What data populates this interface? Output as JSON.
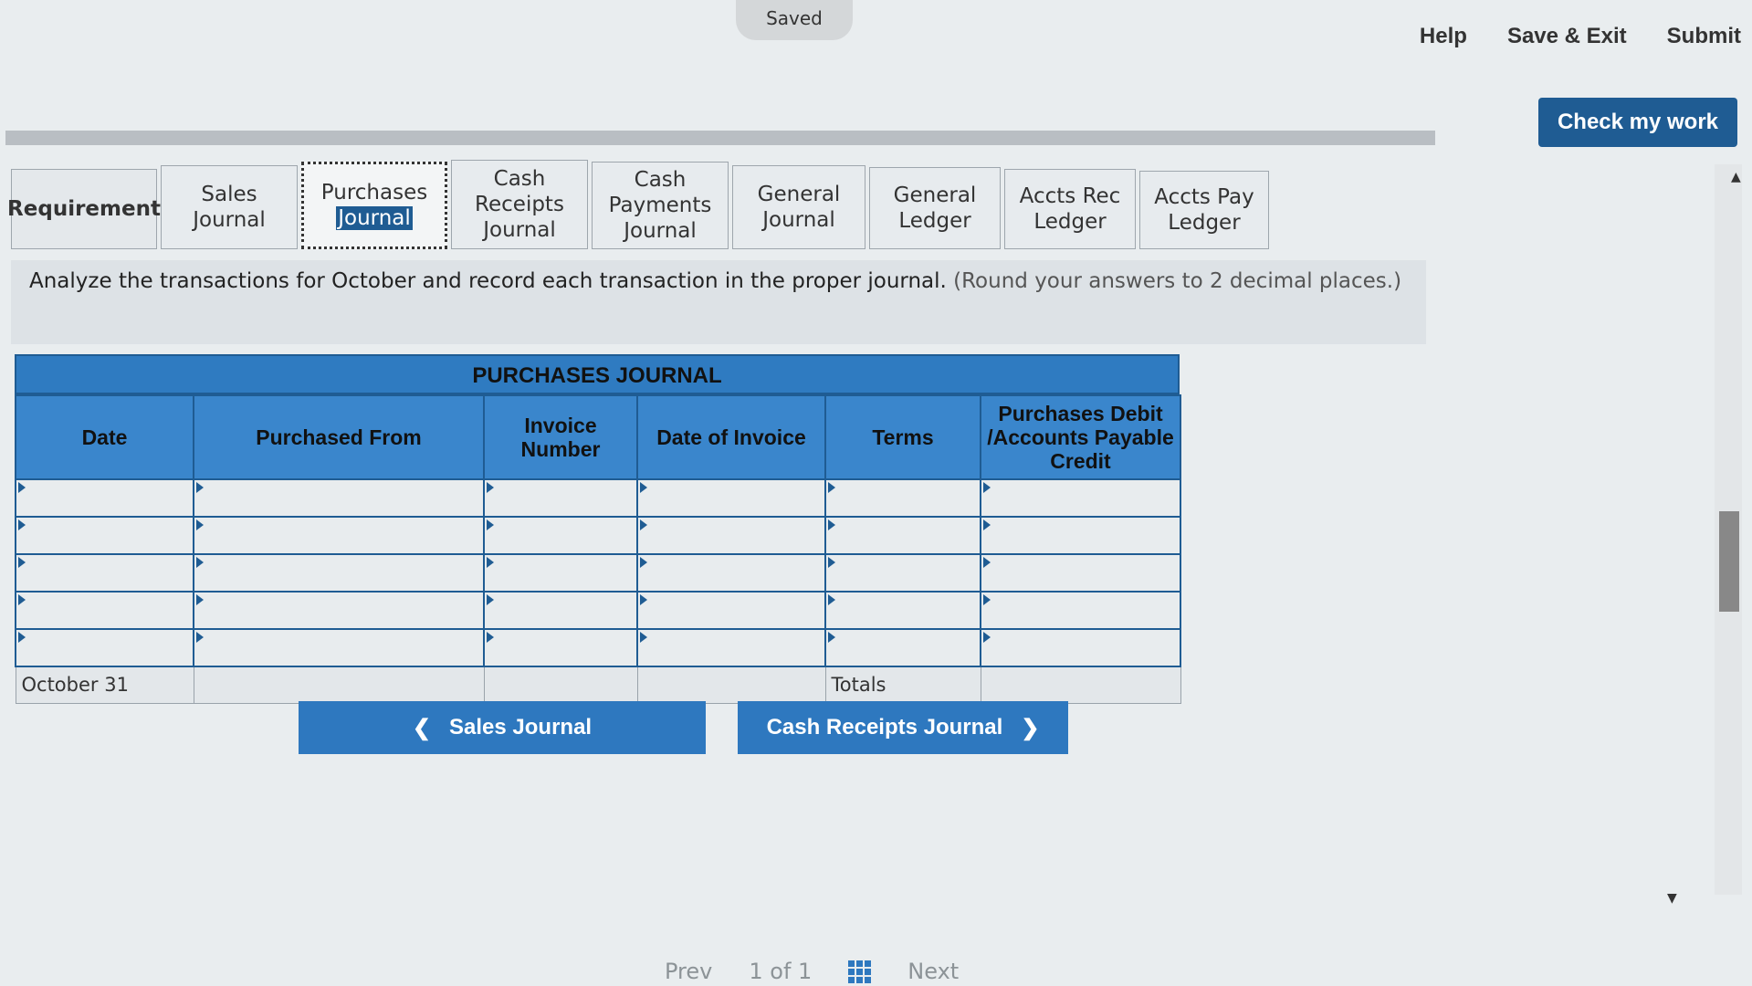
{
  "header": {
    "saved_label": "Saved",
    "links": [
      "Help",
      "Save & Exit",
      "Submit"
    ],
    "check_my_work": "Check my work"
  },
  "tabs": [
    {
      "label1": "Requirement",
      "label2": ""
    },
    {
      "label1": "Sales",
      "label2": "Journal"
    },
    {
      "label1": "Purchases",
      "label2": "Journal"
    },
    {
      "label1": "Cash Receipts",
      "label2": "Journal"
    },
    {
      "label1": "Cash Payments",
      "label2": "Journal"
    },
    {
      "label1": "General",
      "label2": "Journal"
    },
    {
      "label1": "General",
      "label2": "Ledger"
    },
    {
      "label1": "Accts Rec",
      "label2": "Ledger"
    },
    {
      "label1": "Accts Pay",
      "label2": "Ledger"
    }
  ],
  "instructions": {
    "text": "Analyze the transactions for October and record each transaction in the proper journal.",
    "hint": "(Round your answers to 2 decimal places.)"
  },
  "journal": {
    "title": "PURCHASES JOURNAL",
    "columns": [
      "Date",
      "Purchased From",
      "Invoice Number",
      "Date of Invoice",
      "Terms",
      "Purchases Debit /Accounts Payable Credit"
    ],
    "total_row": {
      "date": "October 31",
      "label": "Totals"
    }
  },
  "nav": {
    "prev_label": "Sales Journal",
    "next_label": "Cash Receipts Journal"
  },
  "pager": {
    "prev": "Prev",
    "page_info": "1 of 1",
    "next": "Next"
  }
}
